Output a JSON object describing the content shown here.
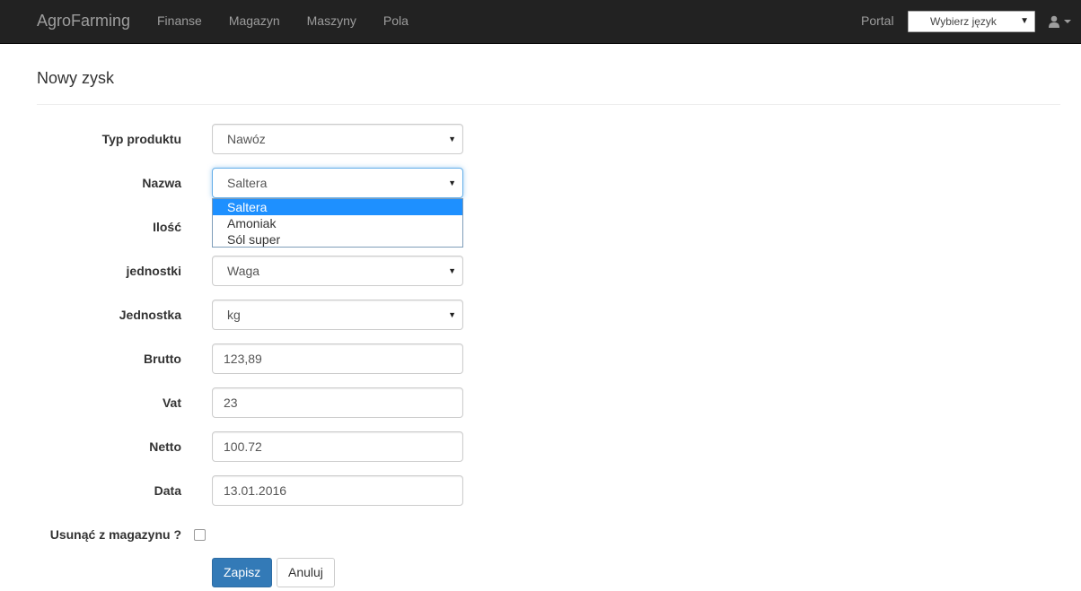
{
  "navbar": {
    "brand": "AgroFarming",
    "links": [
      "Finanse",
      "Magazyn",
      "Maszyny",
      "Pola"
    ],
    "portal": "Portal",
    "language_select": "Wybierz język"
  },
  "page": {
    "title": "Nowy zysk"
  },
  "form": {
    "typ_produktu": {
      "label": "Typ produktu",
      "value": "Nawóz"
    },
    "nazwa": {
      "label": "Nazwa",
      "value": "Saltera",
      "options": [
        "Saltera",
        "Amoniak",
        "Sól super"
      ]
    },
    "ilosc": {
      "label": "Ilość"
    },
    "jednostki": {
      "label": "jednostki",
      "value": "Waga"
    },
    "jednostka": {
      "label": "Jednostka",
      "value": "kg"
    },
    "brutto": {
      "label": "Brutto",
      "value": "123,89"
    },
    "vat": {
      "label": "Vat",
      "value": "23"
    },
    "netto": {
      "label": "Netto",
      "value": "100.72"
    },
    "data": {
      "label": "Data",
      "value": "13.01.2016"
    },
    "usun": {
      "label": "Usunąć z magazynu ?"
    },
    "save_label": "Zapisz",
    "cancel_label": "Anuluj"
  }
}
